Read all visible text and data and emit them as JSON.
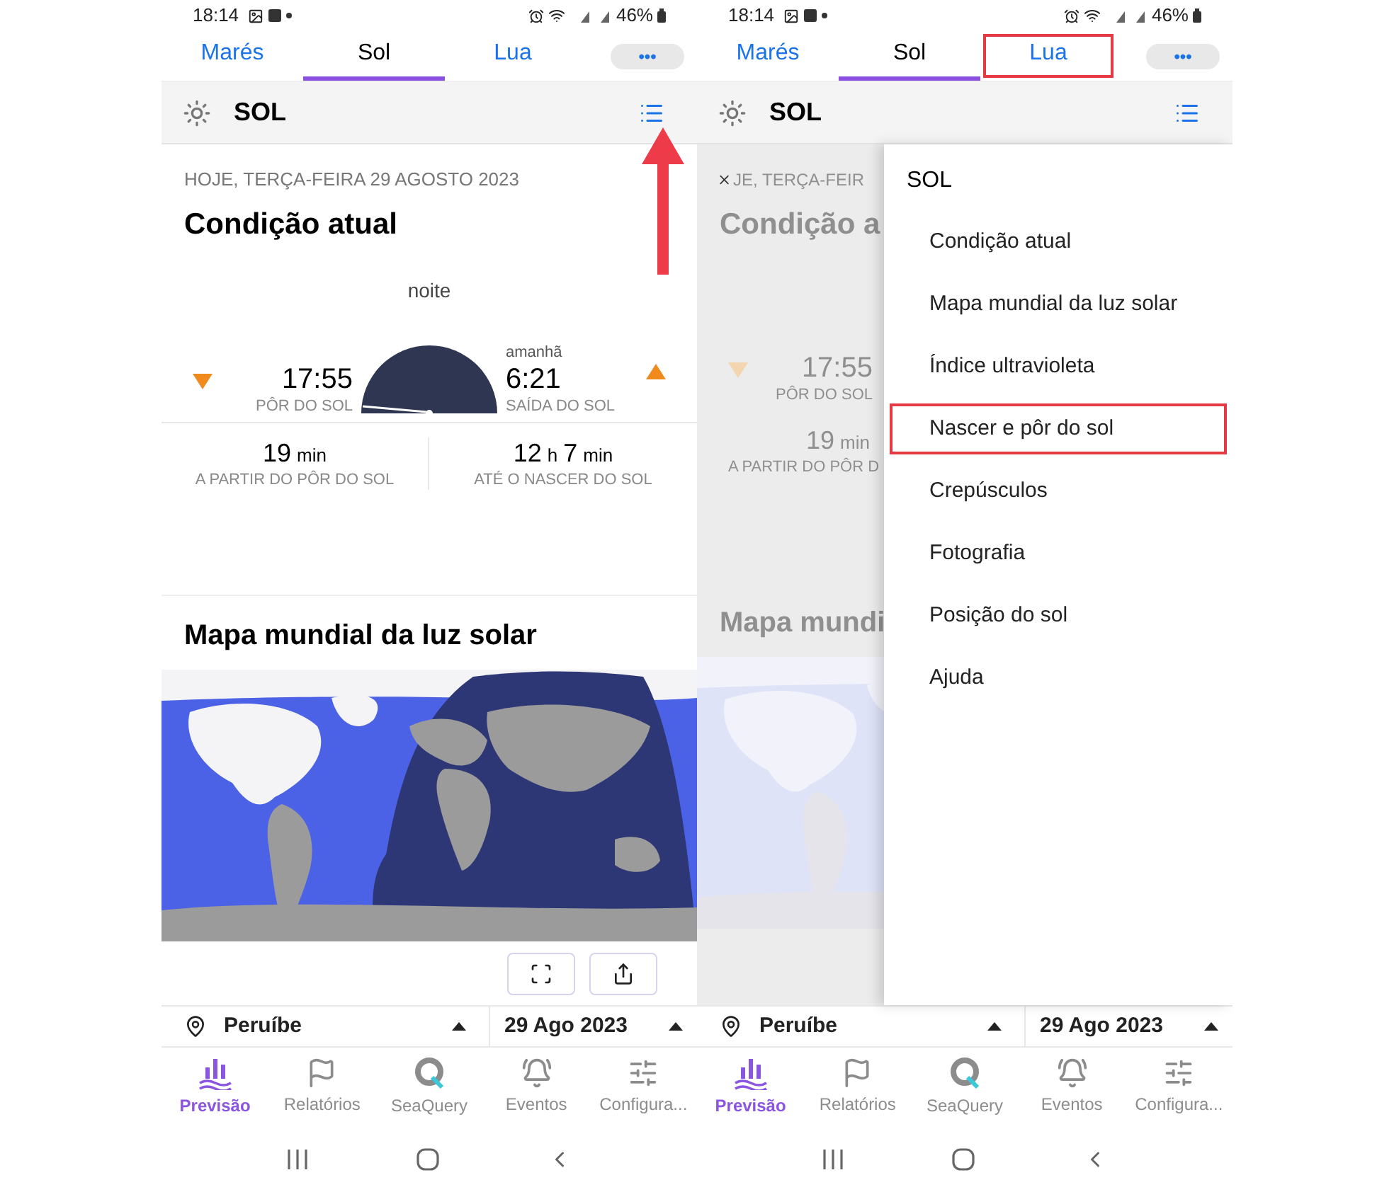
{
  "phones": [
    {
      "kind": "full",
      "status_bar": {
        "time": "18:14",
        "battery": "46%"
      },
      "tabs": [
        {
          "label": "Marés",
          "selected": false,
          "highlighted": false
        },
        {
          "label": "Sol",
          "selected": true,
          "highlighted": false
        },
        {
          "label": "Lua",
          "selected": false,
          "highlighted": false
        }
      ],
      "more_button": "•••",
      "header": {
        "title": "SOL",
        "pointer_arrow": true
      },
      "content": {
        "date": "HOJE, TERÇA-FEIRA 29 AGOSTO 2023",
        "title": "Condição atual",
        "phase": "noite",
        "sunset": {
          "time": "17:55",
          "label": "PÔR DO SOL"
        },
        "sunrise": {
          "note": "amanhã",
          "time": "6:21",
          "label": "SAÍDA DO SOL"
        },
        "counters": [
          {
            "parts": [
              {
                "value": "19",
                "unit": "min"
              }
            ],
            "label": "A PARTIR DO PÔR DO SOL"
          },
          {
            "parts": [
              {
                "value": "12",
                "unit": "h"
              },
              {
                "value": "7",
                "unit": "min"
              }
            ],
            "label": "ATÉ O NASCER DO SOL"
          }
        ],
        "map_title": "Mapa mundial da luz solar"
      },
      "location": "Peruíbe",
      "date": "29 Ago 2023",
      "nav": [
        {
          "label": "Previsão",
          "selected": true
        },
        {
          "label": "Relatórios",
          "selected": false
        },
        {
          "label": "SeaQuery",
          "selected": false
        },
        {
          "label": "Eventos",
          "selected": false
        },
        {
          "label": "Configura...",
          "selected": false
        }
      ]
    },
    {
      "kind": "menu_open",
      "status_bar": {
        "time": "18:14",
        "battery": "46%"
      },
      "tabs": [
        {
          "label": "Marés",
          "selected": false,
          "highlighted": false
        },
        {
          "label": "Sol",
          "selected": true,
          "highlighted": false
        },
        {
          "label": "Lua",
          "selected": false,
          "highlighted": true
        }
      ],
      "more_button": "•••",
      "header": {
        "title": "SOL",
        "pointer_arrow": false
      },
      "faded_content": {
        "date": "JE, TERÇA-FEIR",
        "title": "Condição a",
        "sunset": {
          "time": "17:55",
          "label": "PÔR DO SOL"
        },
        "counter": {
          "value": "19",
          "unit": "min",
          "label": "A PARTIR DO PÔR D"
        },
        "map_title": "Mapa mundi"
      },
      "menu": {
        "title": "SOL",
        "items": [
          {
            "label": "Condição atual",
            "highlighted": false
          },
          {
            "label": "Mapa mundial da luz solar",
            "highlighted": false
          },
          {
            "label": "Índice ultravioleta",
            "highlighted": false
          },
          {
            "label": "Nascer e pôr do sol",
            "highlighted": true
          },
          {
            "label": "Crepúsculos",
            "highlighted": false
          },
          {
            "label": "Fotografia",
            "highlighted": false
          },
          {
            "label": "Posição do sol",
            "highlighted": false
          },
          {
            "label": "Ajuda",
            "highlighted": false
          }
        ]
      },
      "location": "Peruíbe",
      "date": "29 Ago 2023",
      "nav": [
        {
          "label": "Previsão",
          "selected": true
        },
        {
          "label": "Relatórios",
          "selected": false
        },
        {
          "label": "SeaQuery",
          "selected": false
        },
        {
          "label": "Eventos",
          "selected": false
        },
        {
          "label": "Configura...",
          "selected": false
        }
      ]
    }
  ]
}
